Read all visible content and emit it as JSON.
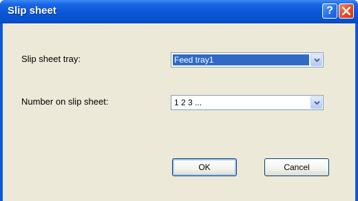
{
  "window": {
    "title": "Slip sheet",
    "help_label": "?",
    "title_icons": [
      "help-icon",
      "close-icon"
    ]
  },
  "form": {
    "tray_label": "Slip sheet tray:",
    "tray_value": "Feed tray1",
    "number_label": "Number on slip sheet:",
    "number_value": "1 2 3 ..."
  },
  "buttons": {
    "ok_label": "OK",
    "cancel_label": "Cancel"
  },
  "colors": {
    "title_bar": "#0a58d8",
    "dialog_background": "#ece9d8",
    "selection": "#316ac5",
    "close_button": "#e3502a"
  }
}
